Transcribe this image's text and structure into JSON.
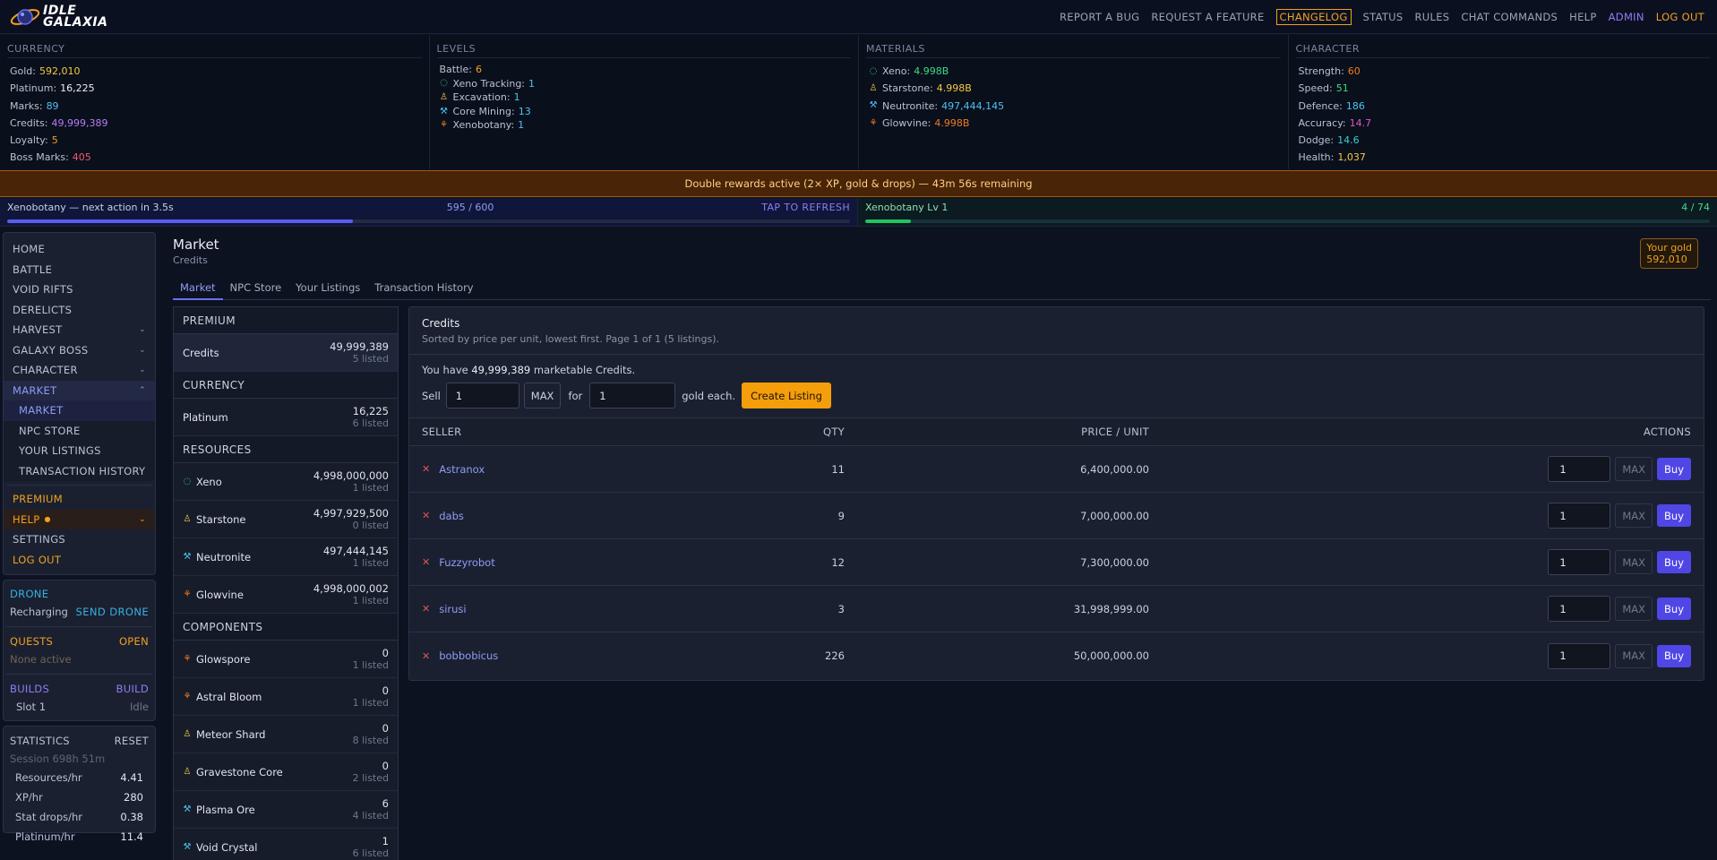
{
  "app": {
    "name_line1": "IDLE",
    "name_line2": "GALAXIA"
  },
  "topnav": [
    "REPORT A BUG",
    "REQUEST A FEATURE",
    "CHANGELOG",
    "STATUS",
    "RULES",
    "CHAT COMMANDS",
    "HELP",
    "ADMIN",
    "LOG OUT"
  ],
  "currency": {
    "title": "CURRENCY",
    "rows": [
      {
        "label": "Gold:",
        "value": "592,010",
        "color": "#f5c842"
      },
      {
        "label": "Platinum:",
        "value": "16,225",
        "color": "#e8ecf4"
      },
      {
        "label": "Marks:",
        "value": "89",
        "color": "#4cc3f0"
      },
      {
        "label": "Credits:",
        "value": "49,999,389",
        "color": "#b47cf5"
      },
      {
        "label": "Loyalty:",
        "value": "5",
        "color": "#f0a020"
      },
      {
        "label": "Boss Marks:",
        "value": "405",
        "color": "#f05a6a"
      }
    ]
  },
  "levels": {
    "title": "LEVELS",
    "rows": [
      {
        "label": "Battle:",
        "value": "6",
        "icon": "",
        "icon_color": "",
        "color": "#f0a020"
      },
      {
        "label": "Xeno Tracking:",
        "value": "1",
        "icon": "xeno-tracking-icon",
        "icon_color": "#3ddc84",
        "color": "#4cc3f0"
      },
      {
        "label": "Excavation:",
        "value": "1",
        "icon": "excavation-icon",
        "icon_color": "#f5c842",
        "color": "#4cc3f0"
      },
      {
        "label": "Core Mining:",
        "value": "13",
        "icon": "core-mining-icon",
        "icon_color": "#4cc3f0",
        "color": "#4cc3f0"
      },
      {
        "label": "Xenobotany:",
        "value": "1",
        "icon": "xenobotany-icon",
        "icon_color": "#f07a20",
        "color": "#4cc3f0"
      }
    ]
  },
  "materials": {
    "title": "MATERIALS",
    "rows": [
      {
        "label": "Xeno:",
        "value": "4.998B",
        "icon": "xeno-icon",
        "icon_color": "#3ddc84",
        "color": "#3ddc84"
      },
      {
        "label": "Starstone:",
        "value": "4.998B",
        "icon": "starstone-icon",
        "icon_color": "#f5c842",
        "color": "#f5c842"
      },
      {
        "label": "Neutronite:",
        "value": "497,444,145",
        "icon": "neutronite-icon",
        "icon_color": "#4cc3f0",
        "color": "#4cc3f0"
      },
      {
        "label": "Glowvine:",
        "value": "4.998B",
        "icon": "glowvine-icon",
        "icon_color": "#f07a20",
        "color": "#f07a20"
      }
    ]
  },
  "character": {
    "title": "CHARACTER",
    "rows": [
      {
        "label": "Strength:",
        "value": "60",
        "color": "#f07a20"
      },
      {
        "label": "Speed:",
        "value": "51",
        "color": "#3ddc84"
      },
      {
        "label": "Defence:",
        "value": "186",
        "color": "#4cc3f0"
      },
      {
        "label": "Accuracy:",
        "value": "14.7",
        "color": "#e055c8"
      },
      {
        "label": "Dodge:",
        "value": "14.6",
        "color": "#38d0d0"
      },
      {
        "label": "Health:",
        "value": "1,037",
        "color": "#f5c842"
      }
    ]
  },
  "banner": "Double rewards active (2× XP, gold & drops) — 43m 56s remaining",
  "progress_left": {
    "label": "Xenobotany — next action in 3.5s",
    "count": "595 / 600",
    "action": "TAP TO REFRESH",
    "fraction": 0.41,
    "color": "#5b5cf0"
  },
  "progress_right": {
    "label": "Xenobotany Lv 1",
    "count": "4 / 74",
    "fraction": 0.054,
    "color": "#22c55e"
  },
  "sidebar": {
    "main": [
      {
        "label": "HOME",
        "chev": ""
      },
      {
        "label": "BATTLE",
        "chev": ""
      },
      {
        "label": "VOID RIFTS",
        "chev": ""
      },
      {
        "label": "DERELICTS",
        "chev": ""
      },
      {
        "label": "HARVEST",
        "chev": "⌄"
      },
      {
        "label": "GALAXY BOSS",
        "chev": "⌄"
      },
      {
        "label": "CHARACTER",
        "chev": "⌄"
      },
      {
        "label": "MARKET",
        "chev": "⌃"
      }
    ],
    "market_sub": [
      "MARKET",
      "NPC STORE",
      "YOUR LISTINGS",
      "TRANSACTION HISTORY"
    ],
    "bottom": {
      "premium": "PREMIUM",
      "help": "HELP",
      "settings": "SETTINGS",
      "logout": "LOG OUT"
    },
    "drone": {
      "title": "DRONE",
      "status": "Recharging",
      "action": "SEND DRONE"
    },
    "quests": {
      "title": "QUESTS",
      "action": "OPEN",
      "status": "None active"
    },
    "builds": {
      "title": "BUILDS",
      "action": "BUILD",
      "slot": "Slot 1",
      "slot_status": "Idle"
    },
    "statistics": {
      "title": "STATISTICS",
      "action": "RESET",
      "session": "Session 698h 51m",
      "rows": [
        {
          "label": "Resources/hr",
          "value": "4.41"
        },
        {
          "label": "XP/hr",
          "value": "280"
        },
        {
          "label": "Stat drops/hr",
          "value": "0.38"
        },
        {
          "label": "Platinum/hr",
          "value": "11.4"
        }
      ]
    }
  },
  "main": {
    "title": "Market",
    "subtitle": "Credits",
    "gold_label": "Your gold",
    "gold_value": "592,010",
    "tabs": [
      "Market",
      "NPC Store",
      "Your Listings",
      "Transaction History"
    ]
  },
  "itemlist": {
    "premium_head": "PREMIUM",
    "premium": [
      {
        "name": "Credits",
        "num": "49,999,389",
        "sub": "5 listed",
        "icon": "",
        "icon_color": ""
      }
    ],
    "currency_head": "CURRENCY",
    "currency": [
      {
        "name": "Platinum",
        "num": "16,225",
        "sub": "6 listed",
        "icon": "",
        "icon_color": ""
      }
    ],
    "resources_head": "RESOURCES",
    "resources": [
      {
        "name": "Xeno",
        "num": "4,998,000,000",
        "sub": "1 listed",
        "icon": "xeno-icon",
        "icon_color": "#3ddc84"
      },
      {
        "name": "Starstone",
        "num": "4,997,929,500",
        "sub": "0 listed",
        "icon": "starstone-icon",
        "icon_color": "#f5c842"
      },
      {
        "name": "Neutronite",
        "num": "497,444,145",
        "sub": "1 listed",
        "icon": "neutronite-icon",
        "icon_color": "#4cc3f0"
      },
      {
        "name": "Glowvine",
        "num": "4,998,000,002",
        "sub": "1 listed",
        "icon": "glowvine-icon",
        "icon_color": "#f07a20"
      }
    ],
    "components_head": "COMPONENTS",
    "components": [
      {
        "name": "Glowspore",
        "num": "0",
        "sub": "1 listed",
        "icon": "glowspore-icon",
        "icon_color": "#f07a20"
      },
      {
        "name": "Astral Bloom",
        "num": "0",
        "sub": "1 listed",
        "icon": "astral-bloom-icon",
        "icon_color": "#f07a20"
      },
      {
        "name": "Meteor Shard",
        "num": "0",
        "sub": "8 listed",
        "icon": "meteor-shard-icon",
        "icon_color": "#f5c842"
      },
      {
        "name": "Gravestone Core",
        "num": "0",
        "sub": "2 listed",
        "icon": "gravestone-core-icon",
        "icon_color": "#f5c842"
      },
      {
        "name": "Plasma Ore",
        "num": "6",
        "sub": "4 listed",
        "icon": "plasma-ore-icon",
        "icon_color": "#4cc3f0"
      },
      {
        "name": "Void Crystal",
        "num": "1",
        "sub": "6 listed",
        "icon": "void-crystal-icon",
        "icon_color": "#4cc3f0"
      }
    ]
  },
  "panel": {
    "title": "Credits",
    "subtitle": "Sorted by price per unit, lowest first. Page 1 of 1 (5 listings).",
    "have_prefix": "You have",
    "have_value": "49,999,389",
    "have_suffix": "marketable Credits.",
    "sell_label": "Sell",
    "sell_qty": "1",
    "max_label": "MAX",
    "for_label": "for",
    "price": "1",
    "gold_each": "gold each.",
    "create_label": "Create Listing",
    "headers": {
      "seller": "SELLER",
      "qty": "QTY",
      "price": "PRICE / UNIT",
      "actions": "ACTIONS"
    },
    "listings": [
      {
        "seller": "Astranox",
        "qty": "11",
        "price": "6,400,000.00",
        "input": "1",
        "max": "MAX",
        "buy": "Buy"
      },
      {
        "seller": "dabs",
        "qty": "9",
        "price": "7,000,000.00",
        "input": "1",
        "max": "MAX",
        "buy": "Buy"
      },
      {
        "seller": "Fuzzyrobot",
        "qty": "12",
        "price": "7,300,000.00",
        "input": "1",
        "max": "MAX",
        "buy": "Buy"
      },
      {
        "seller": "sirusi",
        "qty": "3",
        "price": "31,998,999.00",
        "input": "1",
        "max": "MAX",
        "buy": "Buy"
      },
      {
        "seller": "bobbobicus",
        "qty": "226",
        "price": "50,000,000.00",
        "input": "1",
        "max": "MAX",
        "buy": "Buy"
      }
    ]
  }
}
